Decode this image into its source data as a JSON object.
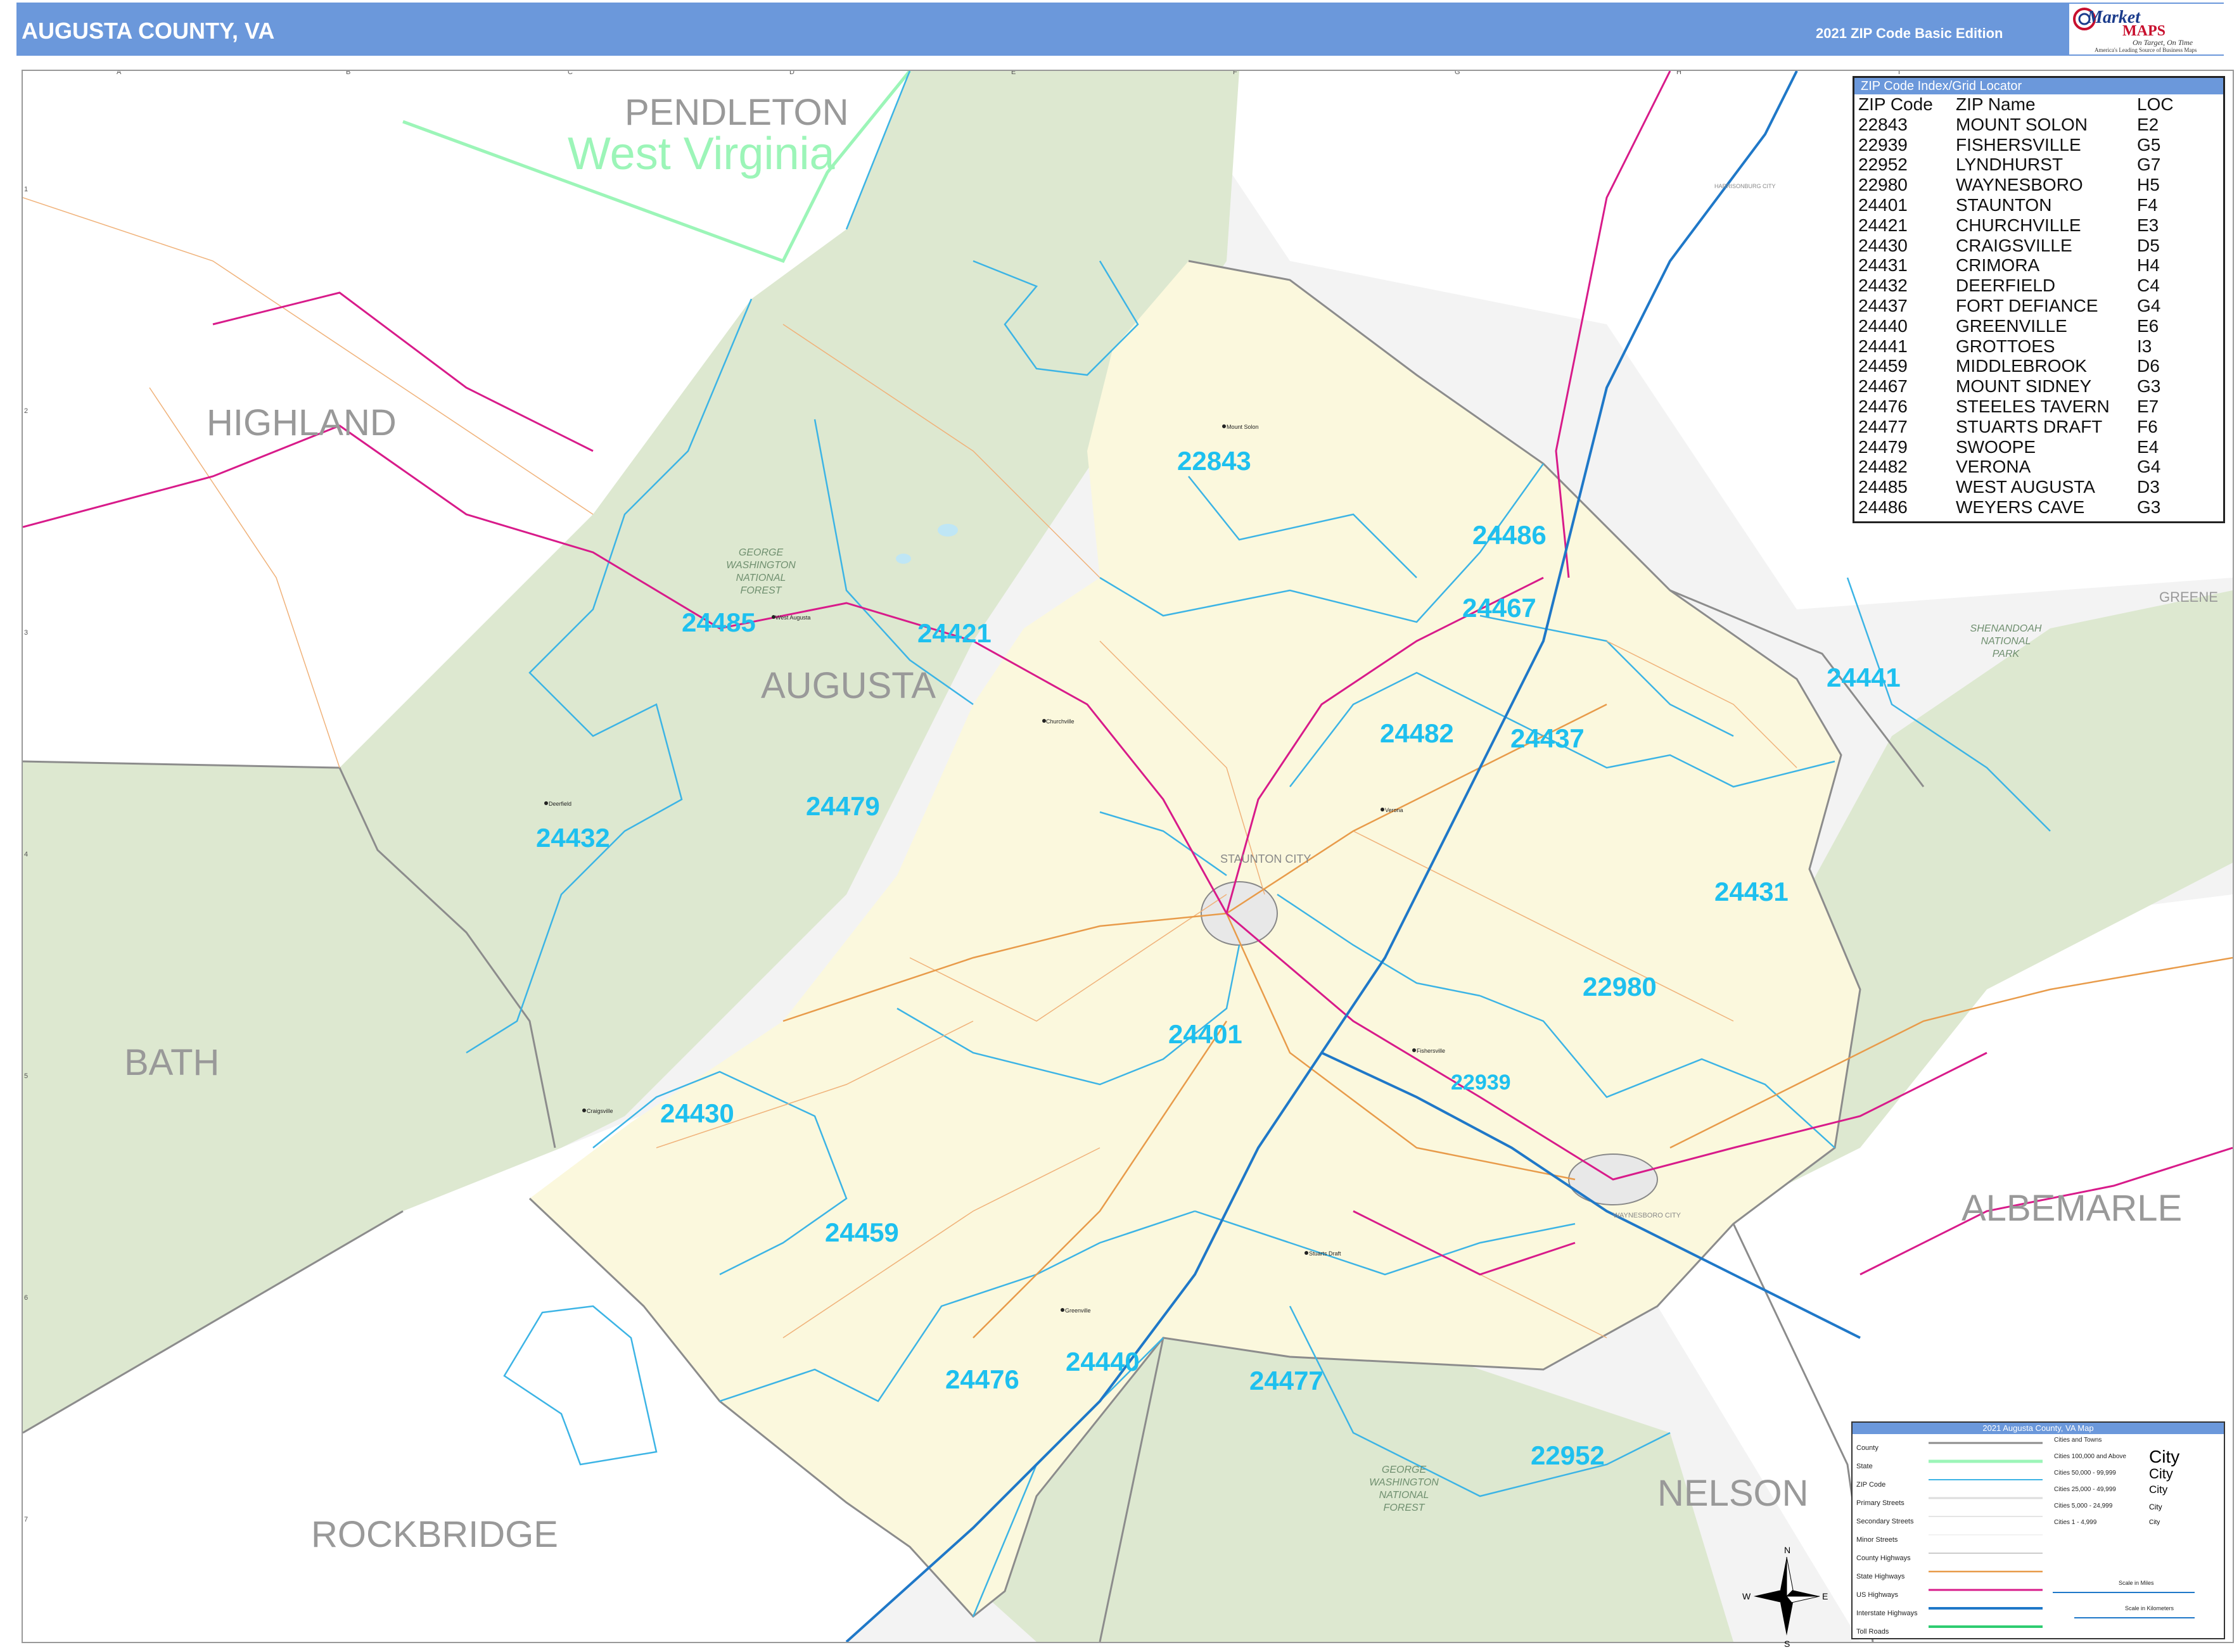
{
  "header": {
    "title": "AUGUSTA COUNTY, VA",
    "edition": "2021 ZIP Code Basic Edition",
    "logo": {
      "line1": "Market",
      "line2": "MAPS",
      "tagline": "On Target, On Time",
      "subtagline": "America's Leading Source of Business Maps"
    }
  },
  "grid": {
    "columns": [
      "A",
      "B",
      "C",
      "D",
      "E",
      "F",
      "G",
      "H",
      "I"
    ],
    "rows": [
      "1",
      "2",
      "3",
      "4",
      "5",
      "6",
      "7"
    ]
  },
  "regions": {
    "pendleton": "PENDLETON",
    "west_virginia": "West Virginia",
    "highland": "HIGHLAND",
    "augusta": "AUGUSTA",
    "bath": "BATH",
    "rockbridge": "ROCKBRIDGE",
    "nelson": "NELSON",
    "albemarle": "ALBEMARLE",
    "greene": "GREENE",
    "gw_forest_north": [
      "GEORGE",
      "WASHINGTON",
      "NATIONAL",
      "FOREST"
    ],
    "gw_forest_south": [
      "GEORGE",
      "WASHINGTON",
      "NATIONAL",
      "FOREST"
    ],
    "shenandoah_park": [
      "SHENANDOAH",
      "NATIONAL",
      "PARK"
    ]
  },
  "zip_labels": {
    "z22843": "22843",
    "z24486": "24486",
    "z24467": "24467",
    "z24485": "24485",
    "z24421": "24421",
    "z24441": "24441",
    "z24482": "24482",
    "z24437": "24437",
    "z24479": "24479",
    "z24432": "24432",
    "z24431": "24431",
    "z22980": "22980",
    "z24401": "24401",
    "z22939": "22939",
    "z24430": "24430",
    "z24459": "24459",
    "z24476": "24476",
    "z24440": "24440",
    "z24477": "24477",
    "z22952": "22952"
  },
  "cities": {
    "staunton": "STAUNTON CITY",
    "waynesboro": "WAYNESBORO CITY",
    "harrisonburg": "HARRISONBURG CITY",
    "west_augusta": "West Augusta",
    "churchville": "Churchville",
    "deerfield": "Deerfield",
    "craigsville": "Craigsville",
    "fishersville": "Fishersville",
    "mount_solon": "Mount Solon",
    "greenville": "Greenville",
    "stuarts_draft": "Stuarts Draft",
    "verona": "Verona"
  },
  "zip_index": {
    "title": "ZIP Code Index/Grid Locator",
    "columns": [
      "ZIP Code",
      "ZIP Name",
      "LOC"
    ],
    "rows": [
      [
        "22843",
        "MOUNT SOLON",
        "E2"
      ],
      [
        "22939",
        "FISHERSVILLE",
        "G5"
      ],
      [
        "22952",
        "LYNDHURST",
        "G7"
      ],
      [
        "22980",
        "WAYNESBORO",
        "H5"
      ],
      [
        "24401",
        "STAUNTON",
        "F4"
      ],
      [
        "24421",
        "CHURCHVILLE",
        "E3"
      ],
      [
        "24430",
        "CRAIGSVILLE",
        "D5"
      ],
      [
        "24431",
        "CRIMORA",
        "H4"
      ],
      [
        "24432",
        "DEERFIELD",
        "C4"
      ],
      [
        "24437",
        "FORT DEFIANCE",
        "G4"
      ],
      [
        "24440",
        "GREENVILLE",
        "E6"
      ],
      [
        "24441",
        "GROTTOES",
        "I3"
      ],
      [
        "24459",
        "MIDDLEBROOK",
        "D6"
      ],
      [
        "24467",
        "MOUNT SIDNEY",
        "G3"
      ],
      [
        "24476",
        "STEELES TAVERN",
        "E7"
      ],
      [
        "24477",
        "STUARTS DRAFT",
        "F6"
      ],
      [
        "24479",
        "SWOOPE",
        "E4"
      ],
      [
        "24482",
        "VERONA",
        "G4"
      ],
      [
        "24485",
        "WEST AUGUSTA",
        "D3"
      ],
      [
        "24486",
        "WEYERS CAVE",
        "G3"
      ]
    ]
  },
  "legend": {
    "title": "2021 Augusta County, VA Map",
    "items": [
      "County",
      "State",
      "ZIP Code",
      "Primary Streets",
      "Secondary Streets",
      "Minor Streets",
      "County Highways",
      "State Highways",
      "US Highways",
      "Interstate Highways",
      "Toll Roads"
    ],
    "cities_header": "Cities and Towns",
    "city_classes": [
      {
        "label": "Cities 100,000 and Above",
        "sample": "City"
      },
      {
        "label": "Cities 50,000 - 99,999",
        "sample": "City"
      },
      {
        "label": "Cities 25,000 - 49,999",
        "sample": "City"
      },
      {
        "label": "Cities 5,000 - 24,999",
        "sample": "City"
      },
      {
        "label": "Cities 1 - 4,999",
        "sample": "City"
      }
    ],
    "scale_miles": "Scale in Miles",
    "scale_km": "Scale in Kilometers"
  },
  "compass": {
    "n": "N",
    "s": "S",
    "e": "E",
    "w": "W"
  },
  "colors": {
    "header": "#6b98db",
    "county_fill": "#fbf8dd",
    "forest_fill": "#dde8d0",
    "zip_line": "#3cb4e5",
    "zip_label": "#1ec0ef",
    "state_line": "#9cf5b8",
    "us_highway": "#d81b8a",
    "interstate": "#1f78c8",
    "state_highway": "#e89b4a"
  }
}
